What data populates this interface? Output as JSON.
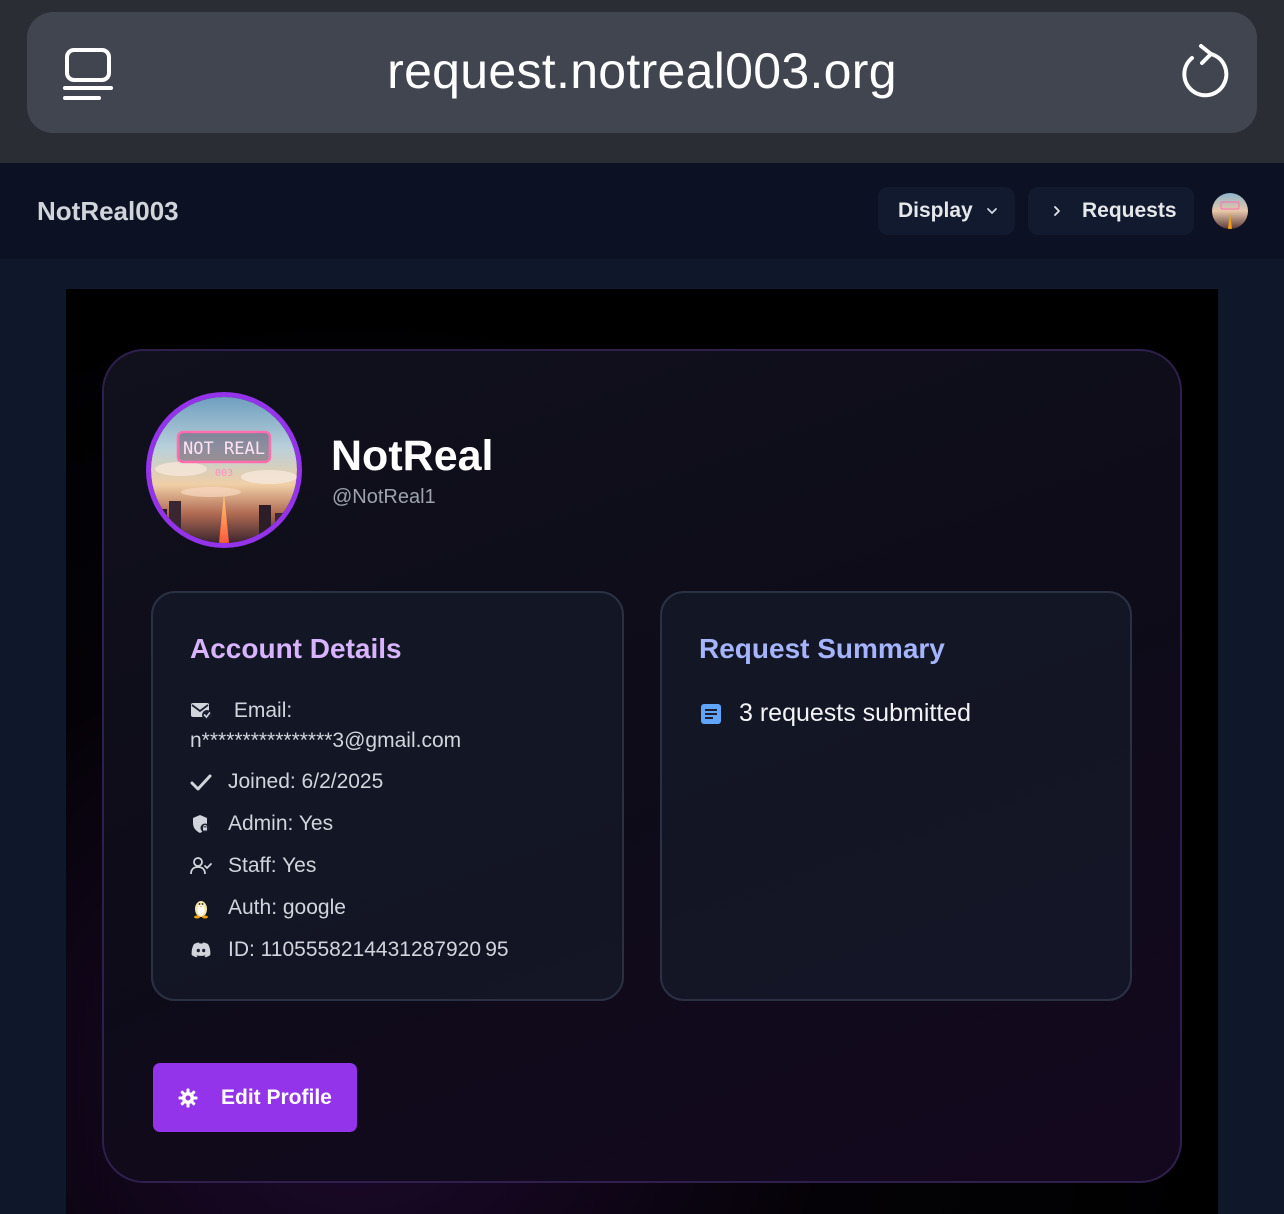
{
  "browser": {
    "url": "request.notreal003.org",
    "tabs_icon": "tabs-icon",
    "reload_icon": "reload-icon"
  },
  "nav": {
    "brand": "NotReal003",
    "display_label": "Display",
    "requests_label": "Requests",
    "avatar_icon": "user-avatar"
  },
  "profile": {
    "name": "NotReal",
    "username": "@NotReal1",
    "avatar_text": "NOT REAL",
    "avatar_subtext": "003"
  },
  "account": {
    "title": "Account Details",
    "email_label": "Email:",
    "email_value": "n****************3@gmail.com",
    "joined": "Joined: 6/2/2025",
    "admin": "Admin: Yes",
    "staff": "Staff: Yes",
    "auth": "Auth: google",
    "id": "ID: 1105558214431287920 95"
  },
  "summary": {
    "title": "Request Summary",
    "requests_text": "3 requests submitted"
  },
  "actions": {
    "edit_label": "Edit Profile"
  },
  "colors": {
    "accent": "#9333ea",
    "account_title": "#d8b4fe",
    "summary_title": "#a5b4fc"
  }
}
